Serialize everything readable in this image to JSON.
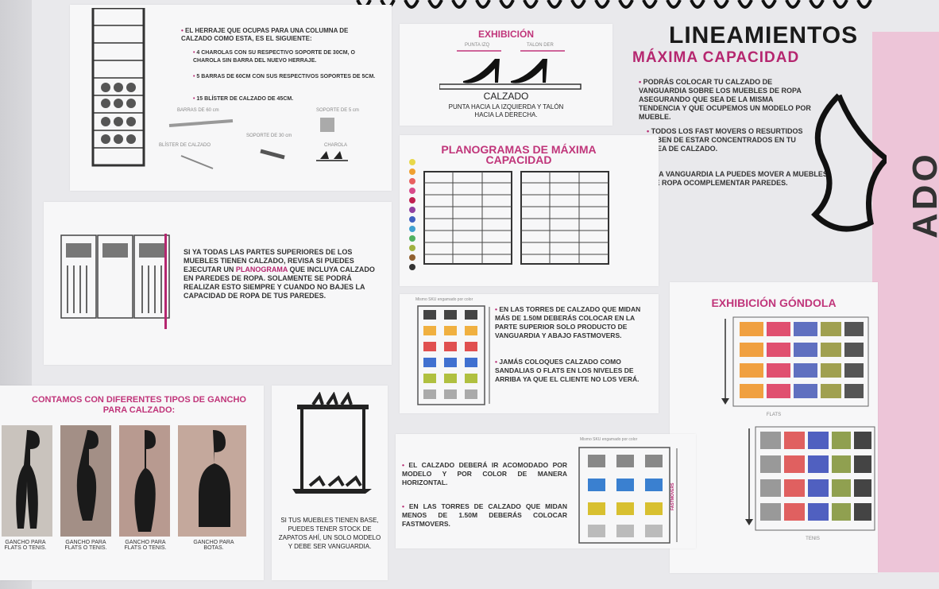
{
  "herraje": {
    "intro": "EL HERRAJE QUE OCUPAS PARA UNA COLUMNA DE CALZADO COMO ESTA, ES EL SIGUIENTE:",
    "items": [
      "4 CHAROLAS CON SU RESPECTIVO SOPORTE DE 30CM, O CHAROLA SIN BARRA DEL NUEVO HERRAJE.",
      "5 BARRAS DE 60CM CON SUS RESPECTIVOS SOPORTES DE 5CM.",
      "15 BLÍSTER DE CALZADO DE 45CM."
    ],
    "labels": {
      "barras": "BARRAS DE 60 cm",
      "soporte5": "SOPORTE DE 5 cm",
      "soporte30": "SOPORTE DE 30 cm",
      "blister": "BLÍSTER DE CALZADO",
      "charola": "CHAROLA"
    }
  },
  "exhibicion": {
    "title": "EXHIBICIÓN",
    "punta": "PUNTA IZQ",
    "talon": "TALON DER",
    "calzado": "CALZADO",
    "desc": "PUNTA HACIA LA IZQUIERDA Y TALÓN HACIA LA DERECHA."
  },
  "lineamientos": {
    "title": "LINEAMIENTOS",
    "subtitle": "MÁXIMA CAPACIDAD",
    "items": [
      "PODRÁS COLOCAR TU CALZADO DE VANGUARDIA SOBRE LOS MUEBLES DE ROPA ASEGURANDO QUE SEA DE LA MISMA TENDENCIA Y QUE OCUPEMOS UN MODELO POR MUEBLE.",
      "TODOS LOS FAST MOVERS O RESURTIDOS DEBEN DE ESTAR CONCENTRADOS EN TU ÁREA DE CALZADO.",
      "LA VANGUARDIA LA PUEDES MOVER A MUEBLES DE ROPA OCOMPLEMENTAR PAREDES."
    ]
  },
  "planogramas": {
    "title": "PLANOGRAMAS DE MÁXIMA CAPACIDAD"
  },
  "muebles": {
    "text_a": "SI YA TODAS LAS PARTES SUPERIORES DE LOS MUEBLES TIENEN CALZADO, REVISA SI PUEDES EJECUTAR UN ",
    "highlight": "PLANOGRAMA",
    "text_b": " QUE INCLUYA CALZADO EN PAREDES DE ROPA. SOLAMENTE SE PODRÁ REALIZAR ESTO SIEMPRE Y CUANDO NO BAJES LA CAPACIDAD DE ROPA DE TUS PAREDES."
  },
  "torres_altas": {
    "label": "Mismo SKU engamado por color",
    "items": [
      "EN LAS TORRES DE CALZADO QUE MIDAN MÁS DE 1.50M DEBERÁS COLOCAR EN LA PARTE SUPERIOR SOLO PRODUCTO DE VANGUARDIA Y ABAJO FASTMOVERS.",
      "JAMÁS COLOQUES CALZADO COMO SANDALIAS O FLATS EN LOS NIVELES DE ARRIBA YA QUE EL CLIENTE NO LOS VERÁ."
    ]
  },
  "gondola": {
    "title": "EXHIBICIÓN GÓNDOLA",
    "flats": "FLATS",
    "tenis": "TENIS"
  },
  "ganchos": {
    "title": "CONTAMOS CON DIFERENTES TIPOS DE GANCHO PARA CALZADO:",
    "labels": [
      "GANCHO PARA FLATS O TENIS.",
      "GANCHO PARA FLATS O TENIS.",
      "GANCHO PARA FLATS O TENIS.",
      "GANCHO PARA BOTAS."
    ]
  },
  "base": {
    "text": "SI TUS MUEBLES TIENEN BASE, PUEDES TENER STOCK DE ZAPATOS AHÍ, UN SOLO MODELO Y DEBE SER VANGUARDIA."
  },
  "torres_bajas": {
    "label": "Mismo SKU engamado por color",
    "vertical": "FASTMOVERS",
    "items": [
      "EL CALZADO DEBERÁ IR ACOMODADO POR MODELO Y POR COLOR DE MANERA HORIZONTAL.",
      "EN LAS TORRES DE CALZADO QUE MIDAN MENOS DE 1.50M DEBERÁS COLOCAR FASTMOVERS."
    ]
  },
  "side": {
    "text": "ADO"
  },
  "colors": {
    "accent": "#b5266f",
    "pink_bg": "#edc5d8"
  }
}
